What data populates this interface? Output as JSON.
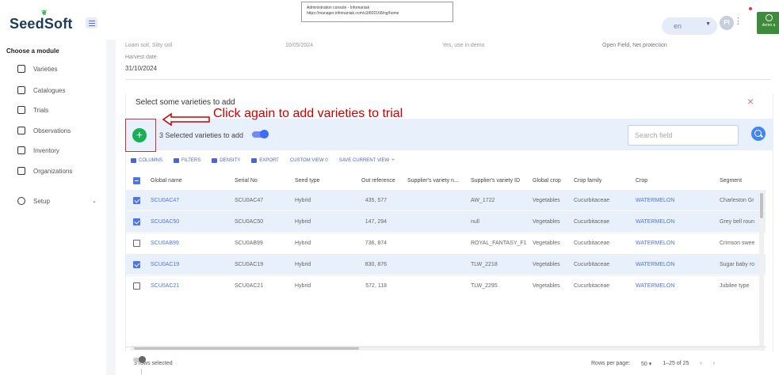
{
  "app": {
    "logo": "SeedSoft",
    "tooltip": {
      "title": "Administration console - Infomaniak",
      "url": "https://manager.infomaniak.com/v3/802168/ng/home"
    },
    "language": "en",
    "avatar_initials": "PI",
    "demo_label": "demo a"
  },
  "sidebar": {
    "heading": "Choose a module",
    "items": [
      {
        "label": "Varieties",
        "icon": "seed-icon"
      },
      {
        "label": "Catalogues",
        "icon": "catalogue-icon"
      },
      {
        "label": "Trials",
        "icon": "trial-icon"
      },
      {
        "label": "Observations",
        "icon": "observation-icon"
      },
      {
        "label": "Inventory",
        "icon": "inventory-icon"
      },
      {
        "label": "Organizations",
        "icon": "organization-icon"
      },
      {
        "label": "Setup",
        "icon": "gear-icon"
      }
    ]
  },
  "trial_info": {
    "row_values": [
      "Loam soil, Silty soil",
      "10/05/2024",
      "Yes, use in demo",
      "Open Field, Net protection"
    ],
    "harvest_label": "Harvest date",
    "harvest_value": "31/10/2024"
  },
  "dialog": {
    "title": "Select some varieties to add",
    "selected_text": "3 Selected varieties to add",
    "search_placeholder": "Search field",
    "add_symbol": "+",
    "close_symbol": "×"
  },
  "annotation": {
    "text": "Click again to add varieties to trial"
  },
  "grid_tools": [
    "COLUMNS",
    "FILTERS",
    "DENSITY",
    "EXPORT",
    "CUSTOM VIEW 0",
    "SAVE CURRENT VIEW"
  ],
  "table": {
    "columns": [
      "Global name",
      "Serial No",
      "Seed type",
      "Out reference",
      "Supplier's variety n...",
      "Supplier's variety ID",
      "Global crop",
      "Crop family",
      "Crop",
      "Segment"
    ],
    "rows": [
      {
        "selected": true,
        "global_name": "SCU0AC47",
        "serial": "SCU0AC47",
        "seed_type": "Hybrid",
        "out_ref": "435, 577",
        "sup_name": "",
        "sup_id": "AW_1722",
        "global_crop": "Vegetables",
        "family": "Cucurbitaceae",
        "crop": "WATERMELON",
        "segment": "Charleston Gr"
      },
      {
        "selected": true,
        "global_name": "SCU0AC50",
        "serial": "SCU0AC50",
        "seed_type": "Hybrid",
        "out_ref": "147, 294",
        "sup_name": "",
        "sup_id": "null",
        "global_crop": "Vegetables",
        "family": "Cucurbitaceae",
        "crop": "WATERMELON",
        "segment": "Grey bell roun"
      },
      {
        "selected": false,
        "global_name": "SCU0AB99",
        "serial": "SCU0AB99",
        "seed_type": "Hybrid",
        "out_ref": "736, 874",
        "sup_name": "",
        "sup_id": "ROYAL_FANTASY_F1",
        "global_crop": "Vegetables",
        "family": "Cucurbitaceae",
        "crop": "WATERMELON",
        "segment": "Crimson swee"
      },
      {
        "selected": true,
        "global_name": "SCU0AC19",
        "serial": "SCU0AC19",
        "seed_type": "Hybrid",
        "out_ref": "830, 876",
        "sup_name": "",
        "sup_id": "TLW_2218",
        "global_crop": "Vegetables",
        "family": "Cucurbitaceae",
        "crop": "WATERMELON",
        "segment": "Sugar baby ro"
      },
      {
        "selected": false,
        "global_name": "SCU0AC21",
        "serial": "SCU0AC21",
        "seed_type": "Hybrid",
        "out_ref": "572, 118",
        "sup_name": "",
        "sup_id": "TLW_2295",
        "global_crop": "Vegetables",
        "family": "Cucurbitaceae",
        "crop": "WATERMELON",
        "segment": "Jubilee type"
      }
    ]
  },
  "footer": {
    "rows_selected": "3 rows selected",
    "rows_per_page_label": "Rows per page:",
    "rows_per_page_value": "50",
    "range": "1–25 of 25"
  },
  "colors": {
    "accent": "#4f74e8",
    "add_button": "#19b055",
    "annotation": "#cc0000",
    "selected_row": "#e8f0fb"
  }
}
